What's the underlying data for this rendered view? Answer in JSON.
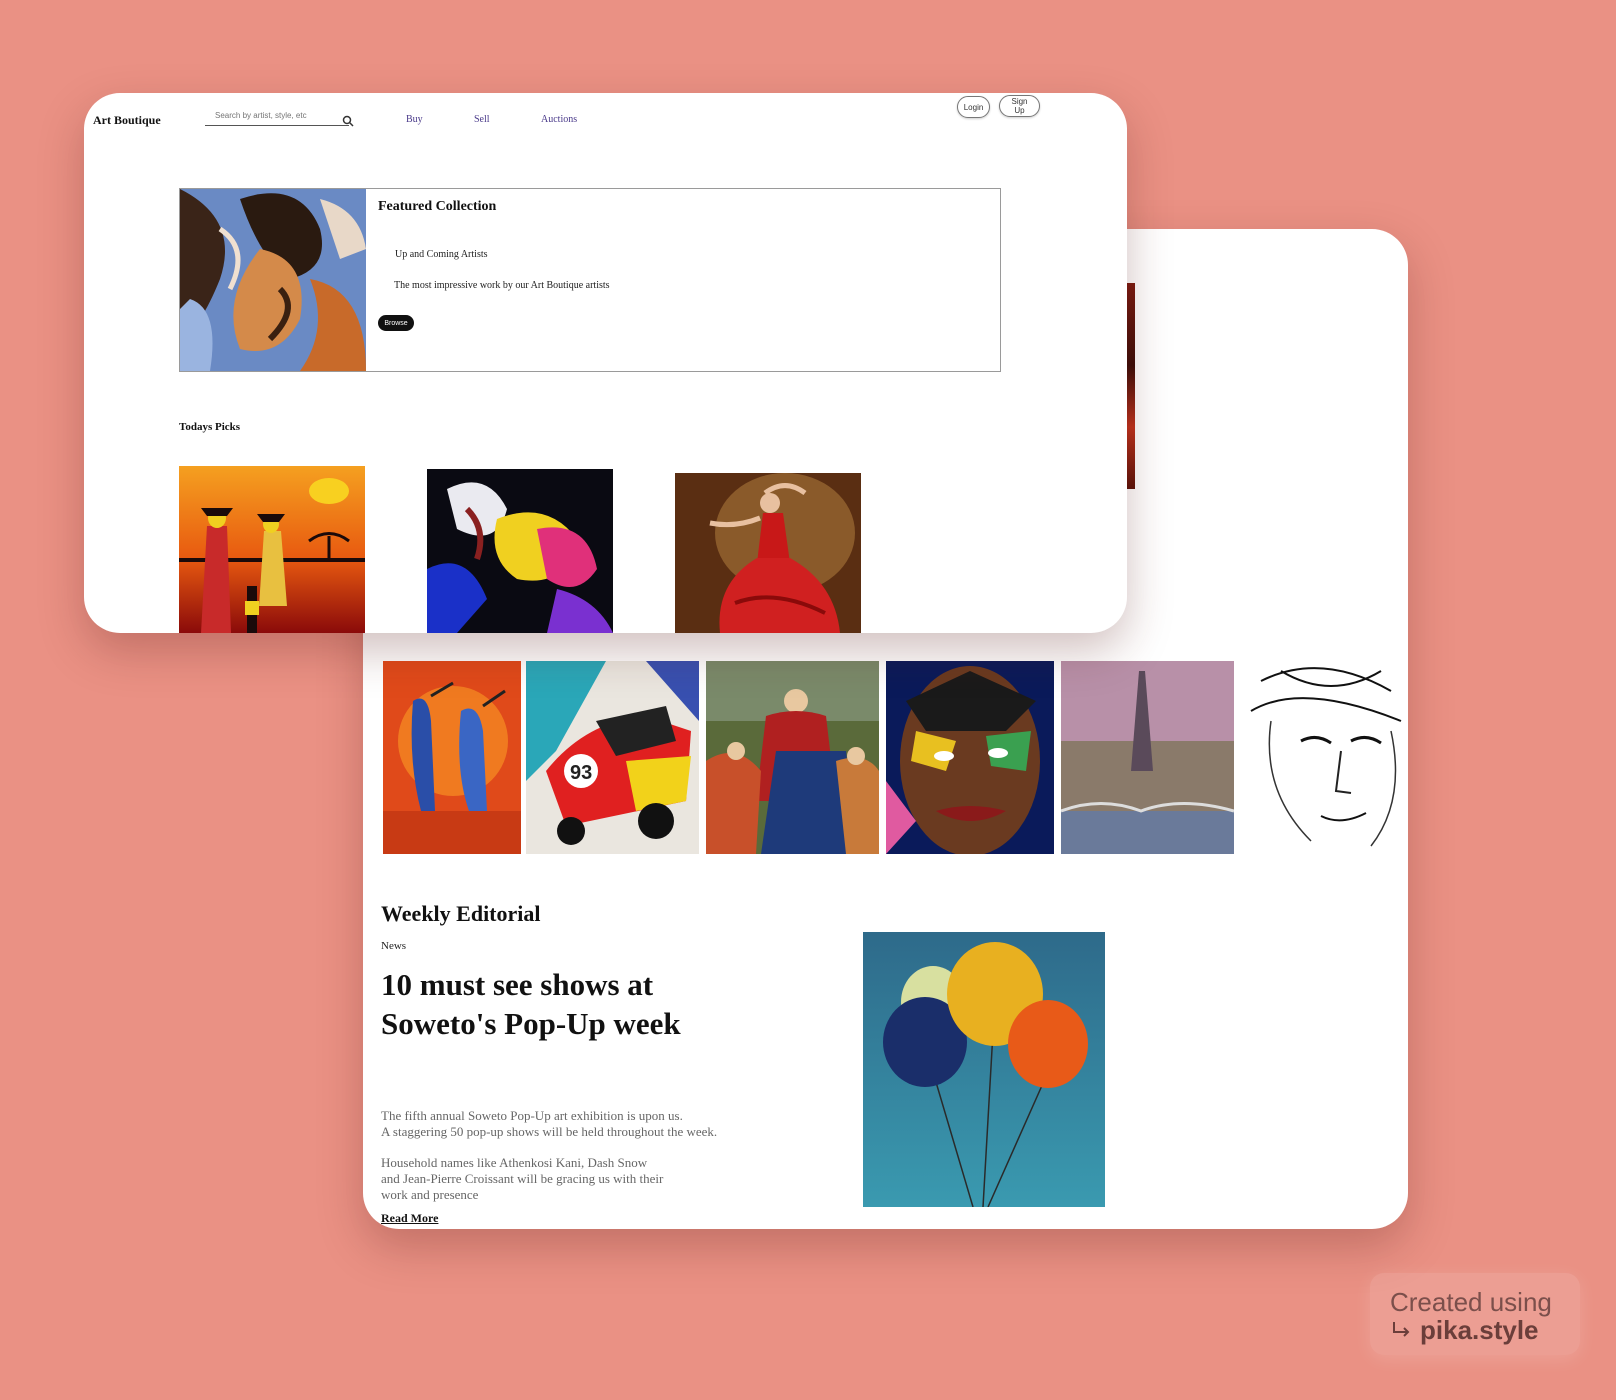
{
  "colors": {
    "background": "#ea9184",
    "nav_link": "#4a3a8a",
    "button_dark": "#111111"
  },
  "header": {
    "brand": "Art Boutique",
    "search_placeholder": "Search by artist, style, etc",
    "search_icon": "search-icon",
    "nav": [
      "Buy",
      "Sell",
      "Auctions"
    ],
    "login": "Login",
    "signup": "Sign Up"
  },
  "featured": {
    "title": "Featured Collection",
    "subtitle": "Up and Coming Artists",
    "description": "The most impressive work by our Art Boutique artists",
    "browse": "Browse"
  },
  "picks": {
    "title": "Todays Picks"
  },
  "editorial": {
    "title": "Weekly Editorial",
    "category": "News",
    "headline": "10 must see shows at Soweto's Pop-Up week",
    "p1": "The fifth annual Soweto Pop-Up art exhibition is upon us.\nA staggering 50 pop-up shows will be held throughout the week.",
    "p2": "Household names like Athenkosi Kani, Dash Snow\nand Jean-Pierre Croissant will be gracing us with their\nwork and presence",
    "read_more": "Read More"
  },
  "watermark": {
    "line1": "Created using",
    "line2": "pika.style",
    "arrow_icon": "return-arrow-icon"
  }
}
